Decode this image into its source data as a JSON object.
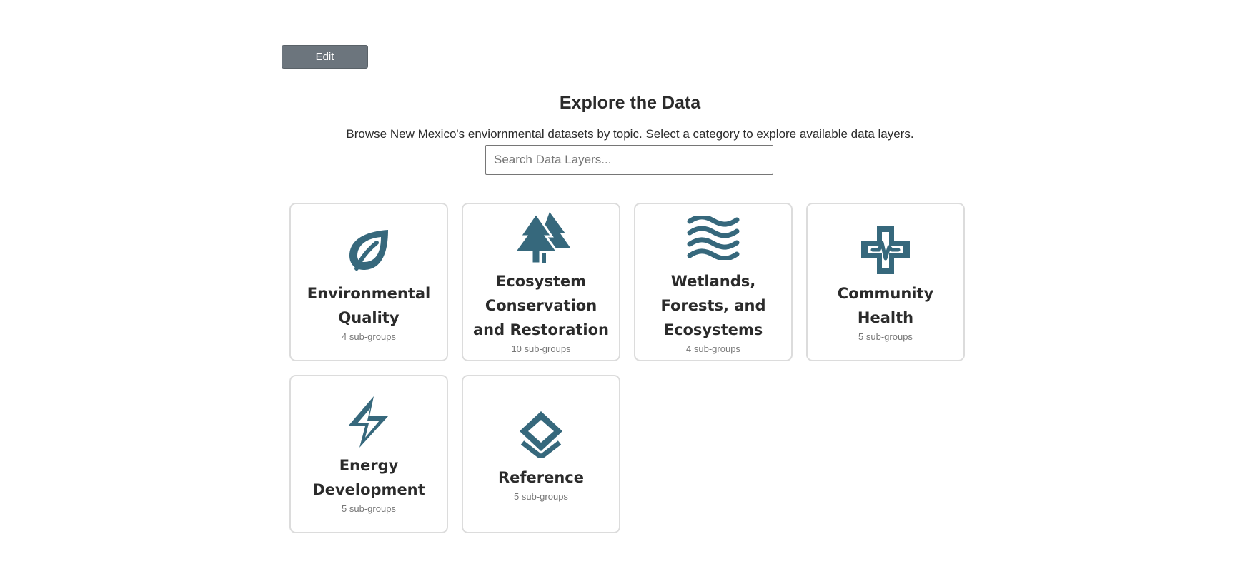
{
  "toolbar": {
    "edit_label": "Edit"
  },
  "header": {
    "title": "Explore the Data",
    "subtitle": "Browse New Mexico's enviornmental datasets by topic. Select a category to explore available data layers."
  },
  "search": {
    "placeholder": "Search Data Layers...",
    "value": ""
  },
  "colors": {
    "icon": "#36687c",
    "card_border": "#dcdcdc",
    "edit_button": "#6c757d"
  },
  "categories": [
    {
      "icon": "leaf-icon",
      "title": "Environmental Quality",
      "count": "4 sub-groups"
    },
    {
      "icon": "trees-icon",
      "title": "Ecosystem Conservation and Restoration",
      "count": "10 sub-groups"
    },
    {
      "icon": "waves-icon",
      "title": "Wetlands, Forests, and Ecosystems",
      "count": "4 sub-groups"
    },
    {
      "icon": "medical-cross-icon",
      "title": "Community Health",
      "count": "5 sub-groups"
    },
    {
      "icon": "lightning-icon",
      "title": "Energy Development",
      "count": "5 sub-groups"
    },
    {
      "icon": "layers-icon",
      "title": "Reference",
      "count": "5 sub-groups"
    }
  ]
}
